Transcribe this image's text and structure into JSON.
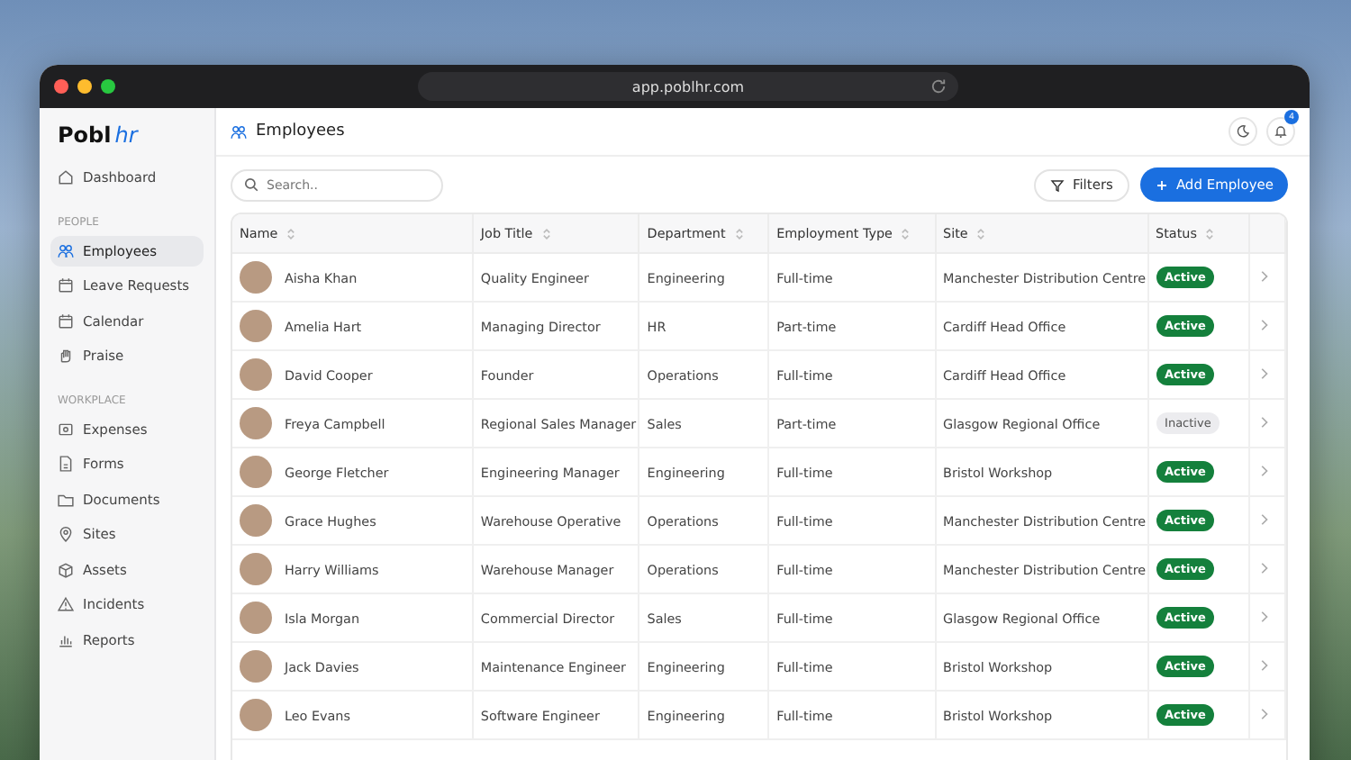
{
  "browser": {
    "url": "app.poblhr.com"
  },
  "logo": {
    "main": "Pobl",
    "accent": "hr"
  },
  "sidebar": {
    "items": [
      {
        "label": "Dashboard",
        "selected": false
      }
    ],
    "sections": [
      {
        "heading": "PEOPLE",
        "items": [
          {
            "label": "Employees",
            "selected": true
          },
          {
            "label": "Leave Requests",
            "selected": false
          },
          {
            "label": "Calendar",
            "selected": false
          },
          {
            "label": "Praise",
            "selected": false
          }
        ]
      },
      {
        "heading": "WORKPLACE",
        "items": [
          {
            "label": "Expenses",
            "selected": false
          },
          {
            "label": "Forms",
            "selected": false
          },
          {
            "label": "Documents",
            "selected": false
          },
          {
            "label": "Sites",
            "selected": false
          },
          {
            "label": "Assets",
            "selected": false
          },
          {
            "label": "Incidents",
            "selected": false
          },
          {
            "label": "Reports",
            "selected": false
          }
        ]
      }
    ]
  },
  "header": {
    "title": "Employees",
    "notifications": "4"
  },
  "search": {
    "placeholder": "Search.."
  },
  "buttons": {
    "filters": "Filters",
    "add": "Add Employee"
  },
  "table": {
    "columns": [
      "Name",
      "Job Title",
      "Department",
      "Employment Type",
      "Site",
      "Status"
    ],
    "rows": [
      {
        "name": "Aisha Khan",
        "job": "Quality Engineer",
        "department": "Engineering",
        "type": "Full-time",
        "site": "Manchester Distribution Centre",
        "status": "Active",
        "active": true
      },
      {
        "name": "Amelia Hart",
        "job": "Managing Director",
        "department": "HR",
        "type": "Part-time",
        "site": "Cardiff Head Office",
        "status": "Active",
        "active": true
      },
      {
        "name": "David Cooper",
        "job": "Founder",
        "department": "Operations",
        "type": "Full-time",
        "site": "Cardiff Head Office",
        "status": "Active",
        "active": true
      },
      {
        "name": "Freya Campbell",
        "job": "Regional Sales Manager",
        "department": "Sales",
        "type": "Part-time",
        "site": "Glasgow Regional Office",
        "status": "Inactive",
        "active": false
      },
      {
        "name": "George Fletcher",
        "job": "Engineering Manager",
        "department": "Engineering",
        "type": "Full-time",
        "site": "Bristol Workshop",
        "status": "Active",
        "active": true
      },
      {
        "name": "Grace Hughes",
        "job": "Warehouse Operative",
        "department": "Operations",
        "type": "Full-time",
        "site": "Manchester Distribution Centre",
        "status": "Active",
        "active": true
      },
      {
        "name": "Harry Williams",
        "job": "Warehouse Manager",
        "department": "Operations",
        "type": "Full-time",
        "site": "Manchester Distribution Centre",
        "status": "Active",
        "active": true
      },
      {
        "name": "Isla Morgan",
        "job": "Commercial Director",
        "department": "Sales",
        "type": "Full-time",
        "site": "Glasgow Regional Office",
        "status": "Active",
        "active": true
      },
      {
        "name": "Jack Davies",
        "job": "Maintenance Engineer",
        "department": "Engineering",
        "type": "Full-time",
        "site": "Bristol Workshop",
        "status": "Active",
        "active": true
      },
      {
        "name": "Leo Evans",
        "job": "Software Engineer",
        "department": "Engineering",
        "type": "Full-time",
        "site": "Bristol Workshop",
        "status": "Active",
        "active": true
      }
    ]
  }
}
